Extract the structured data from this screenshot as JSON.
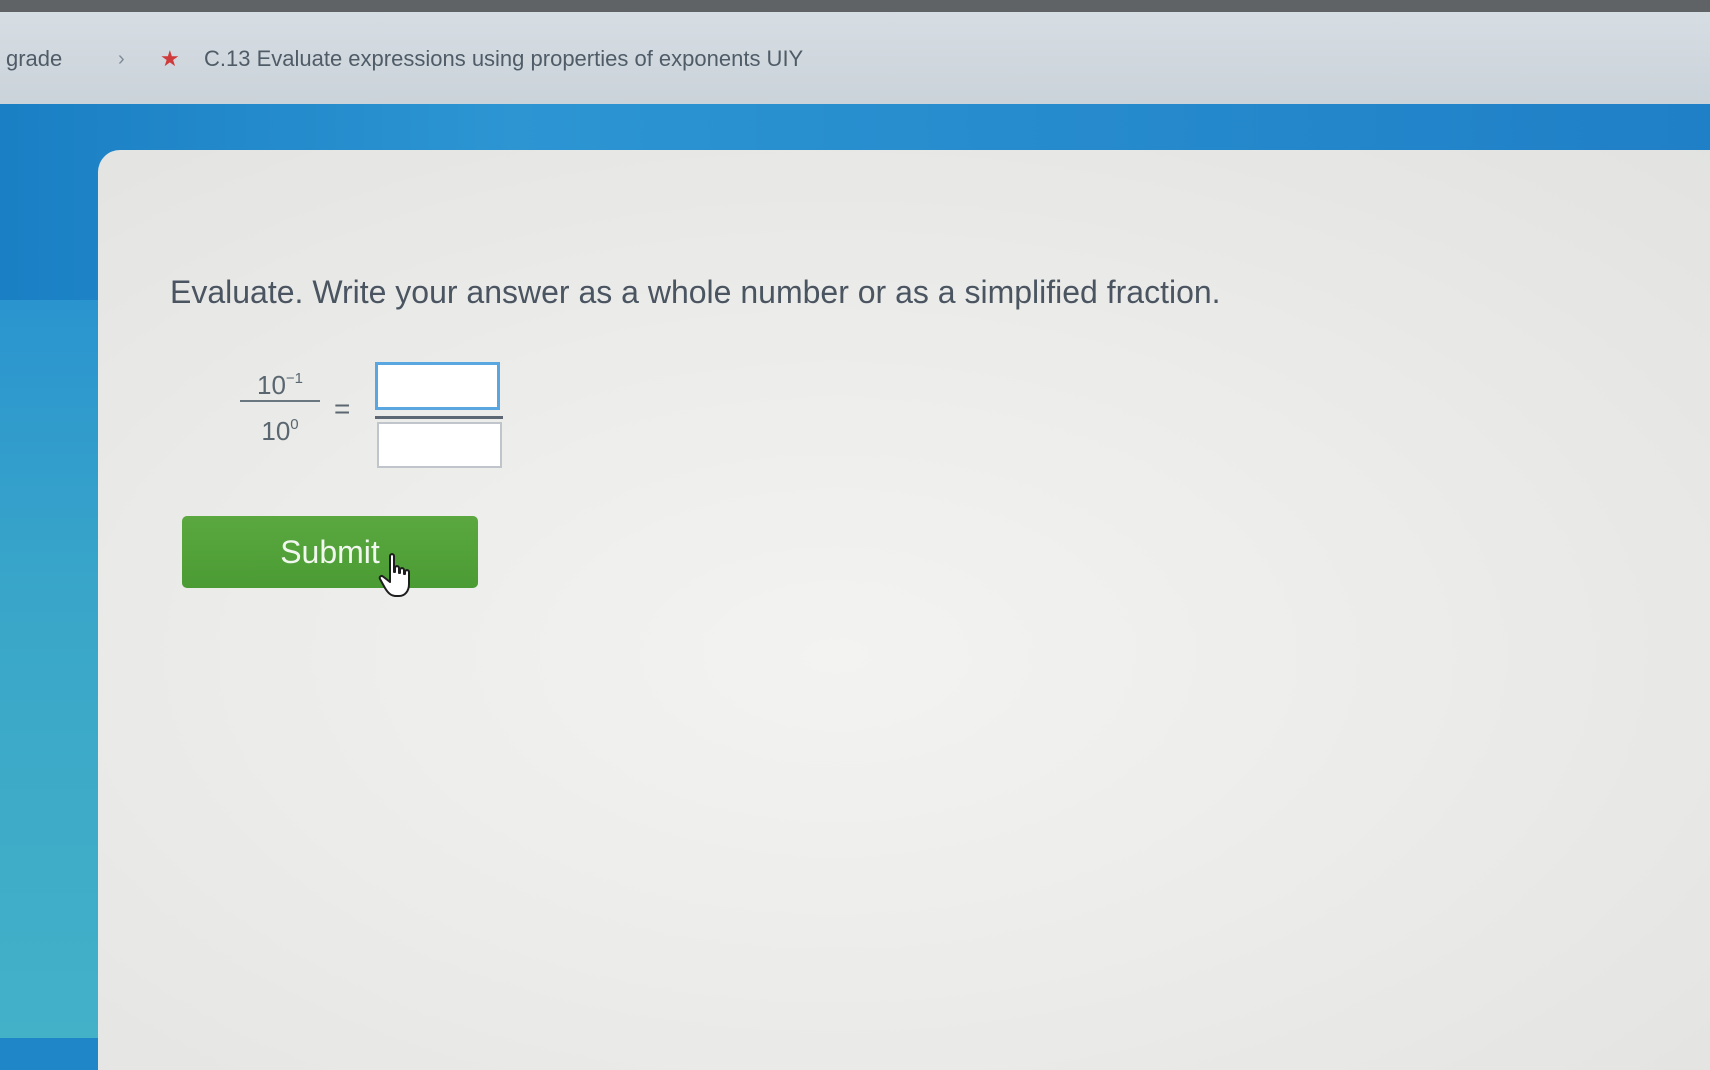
{
  "breadcrumb": {
    "grade": "grade",
    "separator": "›",
    "star": "★",
    "title": "C.13 Evaluate expressions using properties of exponents UIY"
  },
  "question": {
    "instructions": "Evaluate. Write your answer as a whole number or as a simplified fraction.",
    "numerator_base": "10",
    "numerator_exponent": "−1",
    "denominator_base": "10",
    "denominator_exponent": "0",
    "equals": "="
  },
  "answer": {
    "numerator_value": "",
    "denominator_value": ""
  },
  "submit_label": "Submit",
  "colors": {
    "blue": "#1f86c8",
    "green": "#4f9f37",
    "star": "#cf3a3a"
  },
  "icons": {
    "cursor": "hand-pointer-icon"
  }
}
